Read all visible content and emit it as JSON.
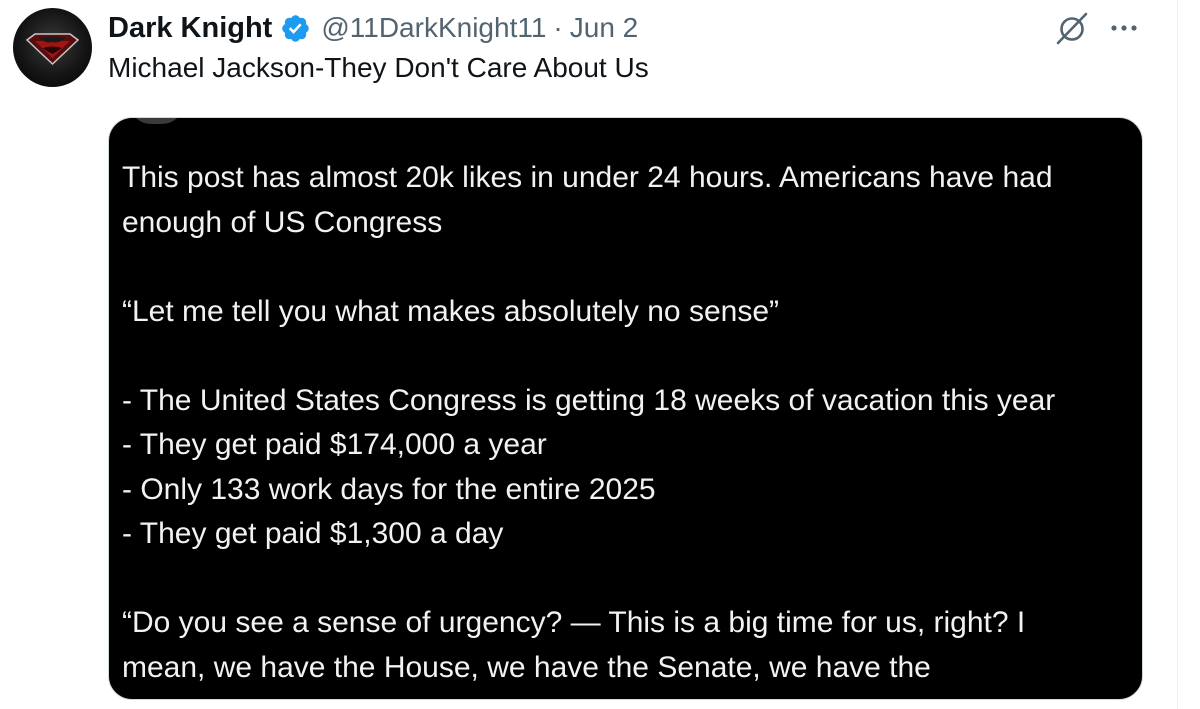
{
  "author": {
    "display_name": "Dark Knight",
    "handle": "@11DarkKnight11",
    "separator": "·",
    "date": "Jun 2",
    "verified": true,
    "avatar_icon": "batman-superman-logo-icon"
  },
  "tweet": {
    "text": "Michael Jackson-They Don't Care About Us"
  },
  "actions": {
    "grok_icon": "grok-icon",
    "more_icon": "more-dots-icon"
  },
  "media": {
    "lines": [
      "This post has almost 20k likes in under 24 hours. Americans have had",
      "enough of US Congress",
      "",
      "“Let me tell you what makes absolutely no sense”",
      "",
      "- The United States Congress is getting 18 weeks of vacation this year",
      "- They get paid $174,000 a year",
      "- Only 133 work days for the entire 2025",
      "- They get paid $1,300 a day",
      "",
      "“Do you see a sense of urgency? — This is a big time for us, right? I",
      "mean, we have the House, we have the Senate, we have the"
    ]
  },
  "colors": {
    "text_primary": "#0f1419",
    "text_secondary": "#536471",
    "verified_blue": "#1d9bf0",
    "media_bg": "#000000",
    "media_text": "#f2f2f2"
  }
}
